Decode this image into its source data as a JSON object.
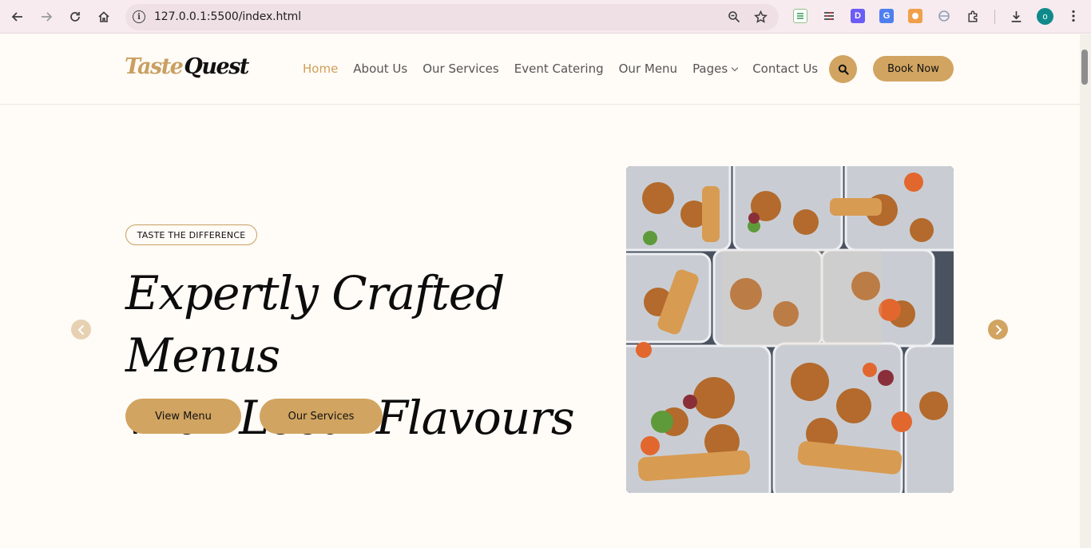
{
  "browser": {
    "url": "127.0.0.1:5500/index.html",
    "profile_initial": "o",
    "icons": [
      "back-icon",
      "forward-icon",
      "reload-icon",
      "home-icon",
      "site-info-icon",
      "zoom-icon",
      "bookmark-star-icon",
      "extensions-icon",
      "download-icon",
      "more-menu-icon"
    ]
  },
  "site": {
    "logo_part1": "Taste",
    "logo_part2": "Quest",
    "nav": [
      {
        "label": "Home"
      },
      {
        "label": "About Us"
      },
      {
        "label": "Our Services"
      },
      {
        "label": "Event Catering"
      },
      {
        "label": "Our Menu"
      },
      {
        "label": "Pages"
      },
      {
        "label": "Contact Us"
      }
    ],
    "book_label": "Book Now"
  },
  "hero": {
    "badge": "TASTE THE DIFFERENCE",
    "headline_line1": "Expertly Crafted Menus",
    "headline_line2": "with Local Flavours",
    "cta_menu": "View Menu",
    "cta_services": "Our Services"
  },
  "colors": {
    "accent": "#d1a461",
    "accent_active": "#cf9f58",
    "background": "#fffbf6"
  }
}
